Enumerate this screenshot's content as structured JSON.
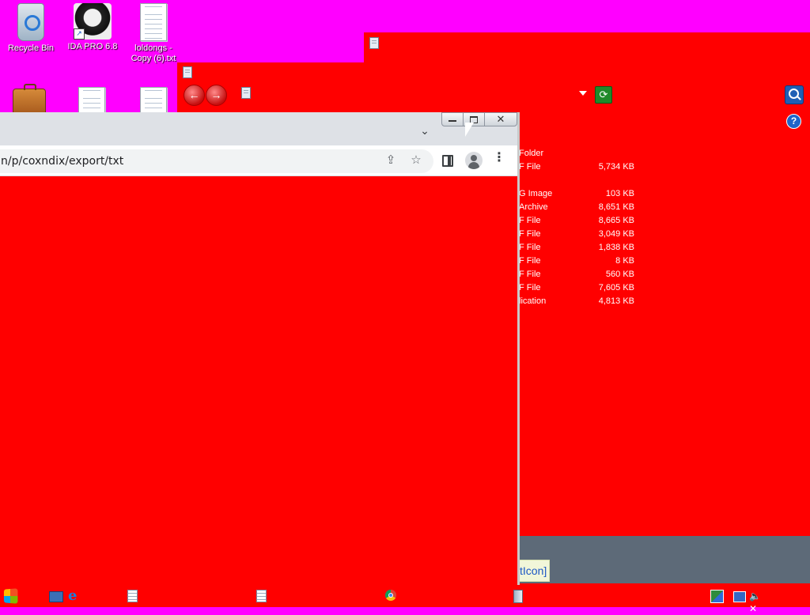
{
  "desktop": {
    "icons": [
      {
        "label": "Recycle Bin",
        "icon": "recycle-bin-icon"
      },
      {
        "label": "IDA PRO 6.8",
        "icon": "ida-pro-icon"
      },
      {
        "label": "loldongs - Copy (6).txt",
        "icon": "text-document-icon"
      }
    ]
  },
  "explorer": {
    "nav_back": "←",
    "nav_forward": "→",
    "refresh_symbol": "⟳",
    "help_symbol": "?",
    "files": [
      {
        "type": "Folder",
        "size": ""
      },
      {
        "type": "F File",
        "size": "5,734 KB"
      },
      {
        "type": "",
        "size": ""
      },
      {
        "type": "G Image",
        "size": "103 KB"
      },
      {
        "type": "Archive",
        "size": "8,651 KB"
      },
      {
        "type": "F File",
        "size": "8,665 KB"
      },
      {
        "type": "F File",
        "size": "3,049 KB"
      },
      {
        "type": "F File",
        "size": "1,838 KB"
      },
      {
        "type": "F File",
        "size": "8 KB"
      },
      {
        "type": "F File",
        "size": "560 KB"
      },
      {
        "type": "F File",
        "size": "7,605 KB"
      },
      {
        "type": "lication",
        "size": "4,813 KB"
      }
    ],
    "status_chip": "tIcon]"
  },
  "browser": {
    "url_path": "n/p/coxndix/export/txt",
    "tab_dropdown_symbol": "⌄",
    "close_symbol": "✕",
    "share_symbol": "⇪",
    "star_symbol": "☆",
    "menu_symbol": "⋮"
  },
  "colors": {
    "desktop_background": "#ff00ff",
    "window_background": "#ff0000",
    "chrome_frame": "#dee1e6"
  }
}
